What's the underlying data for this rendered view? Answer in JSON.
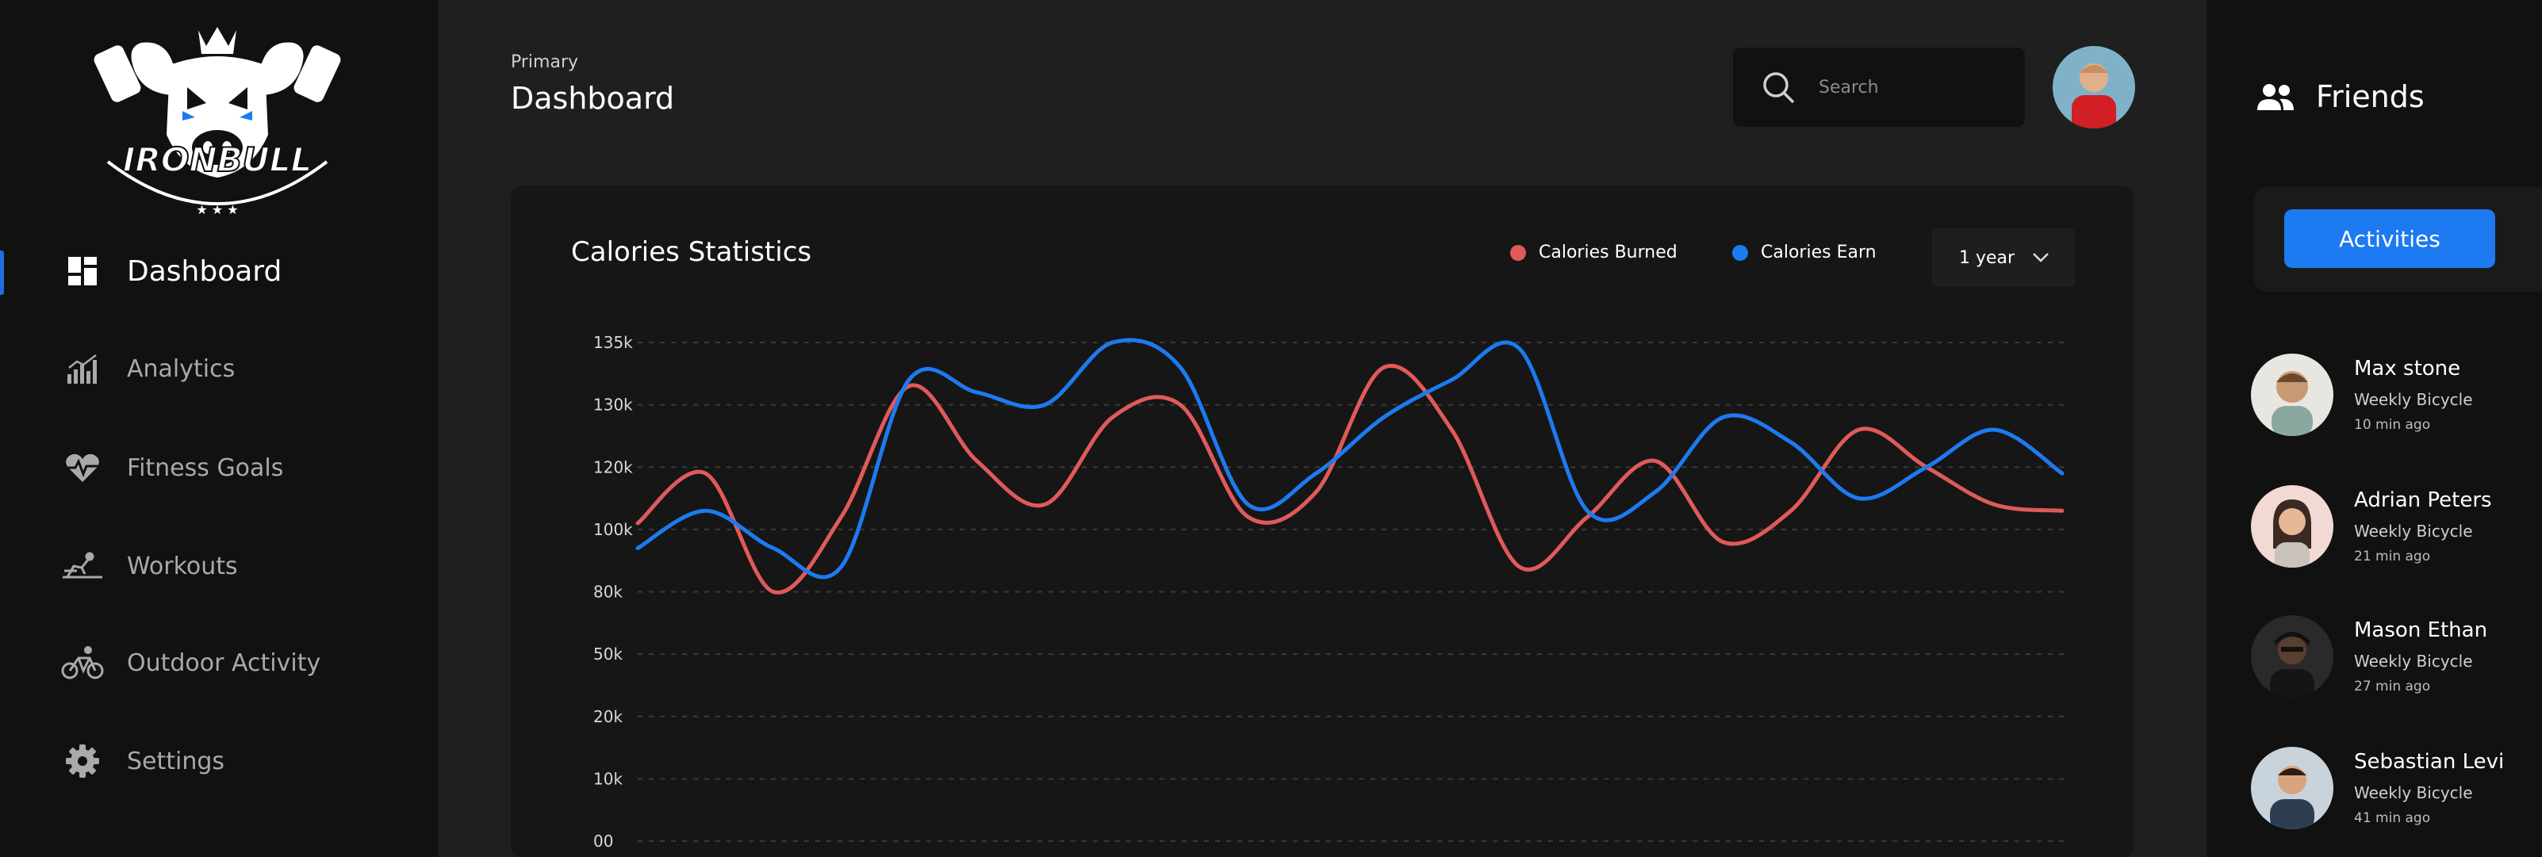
{
  "brand": {
    "logo_text": "IRONBULL"
  },
  "sidebar": {
    "items": [
      {
        "label": "Dashboard",
        "icon": "dashboard-icon",
        "active": true
      },
      {
        "label": "Analytics",
        "icon": "analytics-icon",
        "active": false
      },
      {
        "label": "Fitness Goals",
        "icon": "heart-pulse-icon",
        "active": false
      },
      {
        "label": "Workouts",
        "icon": "workout-icon",
        "active": false
      },
      {
        "label": "Outdoor Activity",
        "icon": "bicycle-icon",
        "active": false
      },
      {
        "label": "Settings",
        "icon": "gear-icon",
        "active": false
      }
    ]
  },
  "header": {
    "breadcrumb": "Primary",
    "title": "Dashboard",
    "search_placeholder": "Search"
  },
  "stats": {
    "title": "Calories Statistics",
    "period": "1 year",
    "legend": [
      {
        "label": "Calories Burned",
        "color": "#e05a5a"
      },
      {
        "label": "Calories Earn",
        "color": "#1d7af0"
      }
    ]
  },
  "chart_data": {
    "type": "line",
    "title": "Calories Statistics",
    "y_ticks": [
      "135k",
      "130k",
      "120k",
      "100k",
      "80k",
      "50k",
      "20k",
      "10k",
      "00"
    ],
    "grid": true,
    "legend_placement": "top-right",
    "series": [
      {
        "name": "Calories Burned",
        "color": "#e05a5a",
        "y_ticks_units": [
          5.1,
          5.9,
          4.0,
          5.2,
          7.3,
          6.1,
          5.4,
          6.8,
          7.0,
          5.2,
          5.6,
          7.6,
          6.6,
          4.4,
          5.2,
          6.1,
          4.8,
          5.3,
          6.6,
          6.0,
          5.4,
          5.3
        ]
      },
      {
        "name": "Calories Earn",
        "color": "#1d7af0",
        "y_ticks_units": [
          4.7,
          5.3,
          4.7,
          4.4,
          7.4,
          7.2,
          7.0,
          8.0,
          7.6,
          5.4,
          5.9,
          6.8,
          7.4,
          7.9,
          5.3,
          5.6,
          6.8,
          6.4,
          5.5,
          6.0,
          6.6,
          5.9
        ]
      }
    ]
  },
  "friends": {
    "title": "Friends",
    "tab_label": "Activities",
    "list": [
      {
        "name": "Max stone",
        "activity": "Weekly Bicycle",
        "time": "10 min ago"
      },
      {
        "name": "Adrian Peters",
        "activity": "Weekly Bicycle",
        "time": "21 min ago"
      },
      {
        "name": "Mason Ethan",
        "activity": "Weekly Bicycle",
        "time": "27 min ago"
      },
      {
        "name": "Sebastian Levi",
        "activity": "Weekly Bicycle",
        "time": "41 min ago"
      }
    ]
  }
}
